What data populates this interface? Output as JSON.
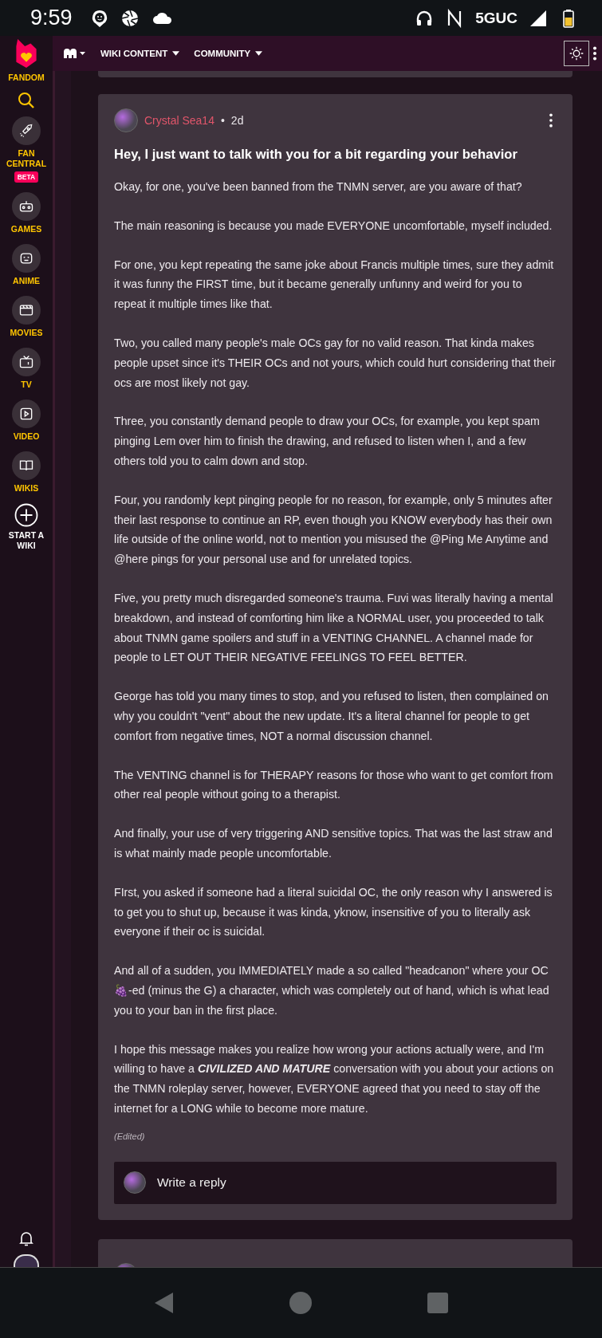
{
  "status_bar": {
    "time": "9:59",
    "network": "5GUC"
  },
  "sidebar": {
    "logo_label": "FANDOM",
    "items": [
      {
        "label": "FAN CENTRAL",
        "badge": "BETA"
      },
      {
        "label": "GAMES"
      },
      {
        "label": "ANIME"
      },
      {
        "label": "MOVIES"
      },
      {
        "label": "TV"
      },
      {
        "label": "VIDEO"
      },
      {
        "label": "WIKIS"
      }
    ],
    "start_wiki": "START A WIKI"
  },
  "header": {
    "nav": [
      "WIKI CONTENT",
      "COMMUNITY"
    ]
  },
  "post": {
    "author": "Crystal Sea14",
    "separator": "•",
    "time": "2d",
    "title": "Hey, I just want to talk with you for a bit regarding your behavior",
    "paragraphs": [
      "Okay, for one, you've been banned from the TNMN server, are you aware of that?",
      "The main reasoning is because you made EVERYONE uncomfortable, myself included.",
      "For one, you kept repeating the same joke about Francis multiple times, sure they admit it was funny the FIRST time, but it became generally unfunny and weird for you to repeat it multiple times like that.",
      "Two, you called many people's male OCs gay for no valid reason. That kinda makes people upset since it's THEIR OCs and not yours, which could hurt considering that their ocs are most likely not gay.",
      "Three, you constantly demand people to draw your OCs, for example, you kept spam pinging Lem over him to finish the drawing, and refused to listen when I, and a few others told you to calm down and stop.",
      "Four, you randomly kept pinging people for no reason, for example, only 5 minutes after their last response to continue an RP, even though you KNOW everybody has their own life outside of the online world, not to mention you misused the @Ping Me Anytime and @here pings for your personal use and for unrelated topics.",
      "Five, you pretty much disregarded someone's trauma. Fuvi was literally having a mental breakdown, and instead of comforting him like a NORMAL user, you proceeded to talk about TNMN game spoilers and stuff in a VENTING CHANNEL. A channel made for people to LET OUT THEIR NEGATIVE FEELINGS TO FEEL BETTER.",
      "George has told you many times to stop, and you refused to listen, then complained on why you couldn't \"vent\" about the new update. It's a literal channel for people to get comfort from negative times, NOT a normal discussion channel.",
      "The VENTING channel is for THERAPY reasons for those who want to get comfort from other real people without going to a therapist.",
      "And finally, your use of very triggering AND sensitive topics. That was the last straw and is what mainly made people uncomfortable.",
      "FIrst, you asked if someone had a literal suicidal OC, the only reason why I answered is to get you to shut up, because it was kinda, yknow, insensitive of you to literally ask everyone if their oc is suicidal.",
      "And all of a sudden, you IMMEDIATELY made a so called \"headcanon\" where your OC 🍇-ed (minus the G) a character, which was completely out of hand, which is what lead you to your ban in the first place.",
      "I hope this message makes you realize how wrong your actions actually were, and I'm willing to have a **CIVILIZED AND MATURE** conversation with you about your actions on the TNMN roleplay server, however, EVERYONE agreed that you need to stay off the internet for a LONG while to become more mature."
    ],
    "edited": "(Edited)",
    "reply": {
      "placeholder": "Write a reply"
    }
  }
}
